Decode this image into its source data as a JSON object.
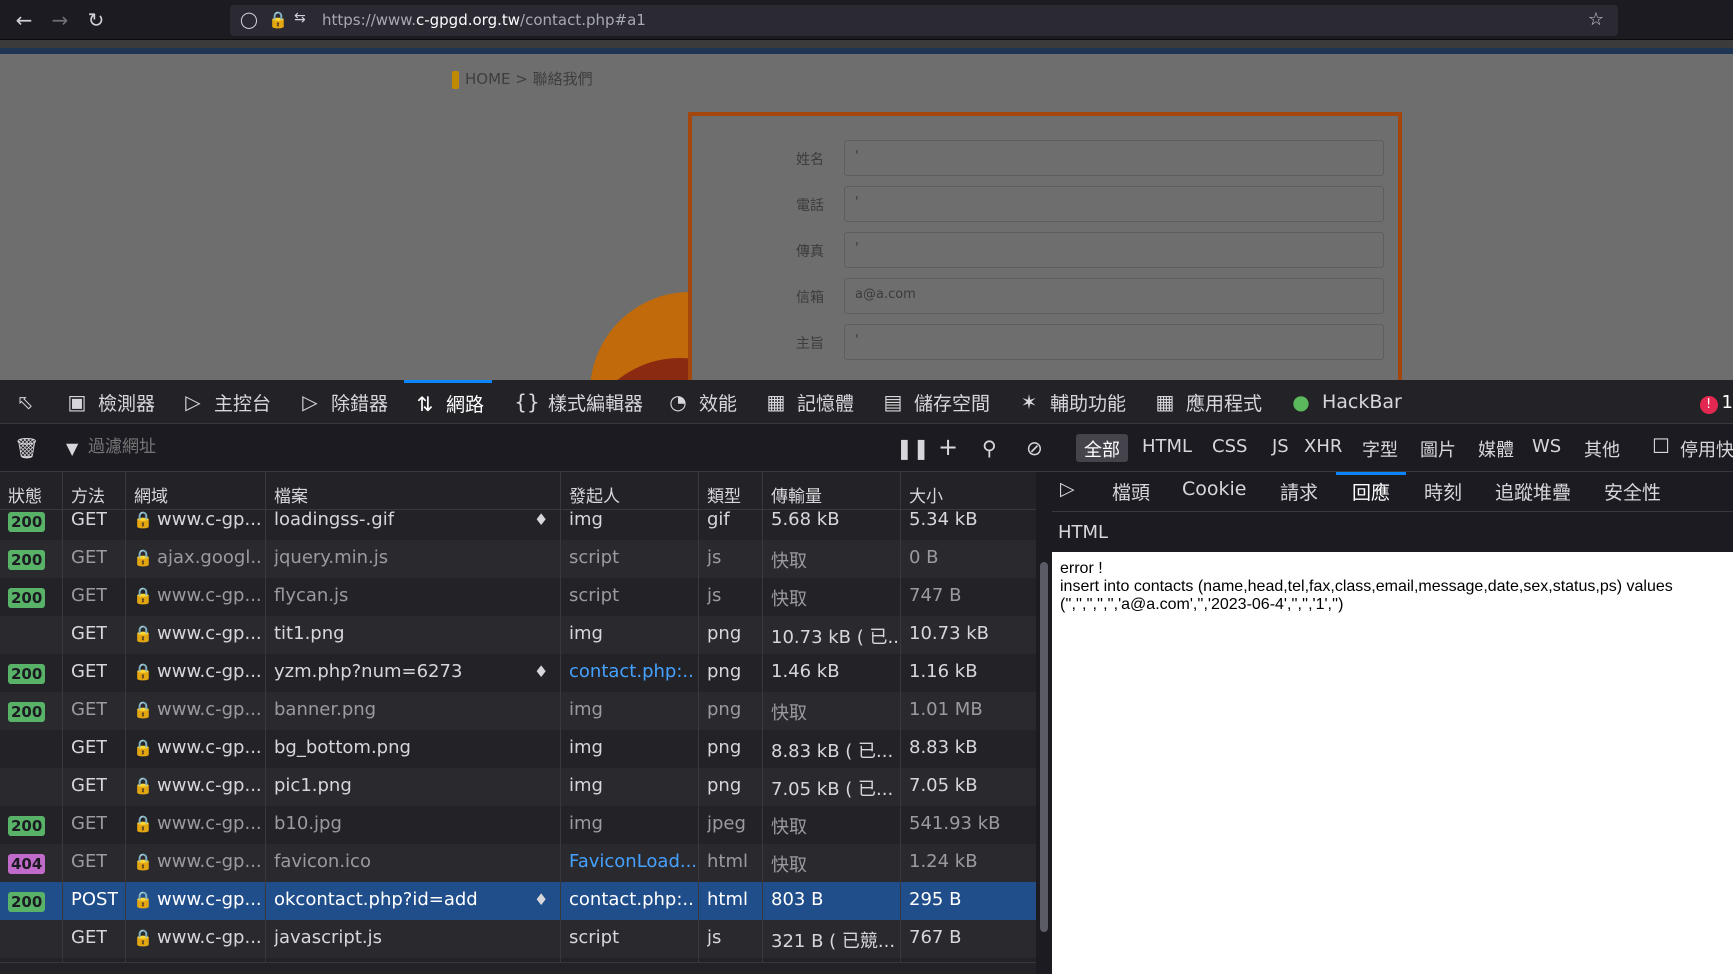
{
  "browser": {
    "url_prefix": "https://www.",
    "url_domain": "c-gpgd.org.tw",
    "url_suffix": "/contact.php#a1"
  },
  "page": {
    "breadcrumb": "HOME > 聯絡我們",
    "form": [
      {
        "label": "姓名",
        "value": "'"
      },
      {
        "label": "電話",
        "value": "'"
      },
      {
        "label": "傳真",
        "value": "'"
      },
      {
        "label": "信箱",
        "value": "a@a.com"
      },
      {
        "label": "主旨",
        "value": "'"
      }
    ]
  },
  "devtools": {
    "tabs": [
      "檢測器",
      "主控台",
      "除錯器",
      "網路",
      "樣式編輯器",
      "效能",
      "記憶體",
      "儲存空間",
      "輔助功能",
      "應用程式",
      "HackBar"
    ],
    "active_tab": "網路",
    "error_count": "1",
    "filter_placeholder": "過濾網址",
    "type_filters": [
      "全部",
      "HTML",
      "CSS",
      "JS",
      "XHR",
      "字型",
      "圖片",
      "媒體",
      "WS",
      "其他"
    ],
    "disable_cache_label": "停用快",
    "columns": [
      "狀態",
      "方法",
      "網域",
      "檔案",
      "發起人",
      "類型",
      "傳輸量",
      "大小"
    ],
    "rows": [
      {
        "status": "200",
        "method": "GET",
        "domain": "www.c-gp...",
        "file": "loadingss-.gif",
        "initiator": "img",
        "type": "gif",
        "transferred": "5.68 kB",
        "size": "5.34 kB",
        "throttled": true,
        "cached": false
      },
      {
        "status": "200",
        "method": "GET",
        "domain": "ajax.googl...",
        "file": "jquery.min.js",
        "initiator": "script",
        "type": "js",
        "transferred": "快取",
        "size": "0 B",
        "throttled": false,
        "cached": true
      },
      {
        "status": "200",
        "method": "GET",
        "domain": "www.c-gp...",
        "file": "flycan.js",
        "initiator": "script",
        "type": "js",
        "transferred": "快取",
        "size": "747 B",
        "throttled": false,
        "cached": true
      },
      {
        "status": "",
        "method": "GET",
        "domain": "www.c-gp...",
        "file": "tit1.png",
        "initiator": "img",
        "type": "png",
        "transferred": "10.73 kB ( 已...",
        "size": "10.73 kB",
        "throttled": false,
        "cached": false
      },
      {
        "status": "200",
        "method": "GET",
        "domain": "www.c-gp...",
        "file": "yzm.php?num=6273",
        "initiator": "contact.php:...",
        "initiator_link": true,
        "type": "png",
        "transferred": "1.46 kB",
        "size": "1.16 kB",
        "throttled": true,
        "cached": false
      },
      {
        "status": "200",
        "method": "GET",
        "domain": "www.c-gp...",
        "file": "banner.png",
        "initiator": "img",
        "type": "png",
        "transferred": "快取",
        "size": "1.01 MB",
        "throttled": false,
        "cached": true
      },
      {
        "status": "",
        "method": "GET",
        "domain": "www.c-gp...",
        "file": "bg_bottom.png",
        "initiator": "img",
        "type": "png",
        "transferred": "8.83 kB ( 已...",
        "size": "8.83 kB",
        "throttled": false,
        "cached": false
      },
      {
        "status": "",
        "method": "GET",
        "domain": "www.c-gp...",
        "file": "pic1.png",
        "initiator": "img",
        "type": "png",
        "transferred": "7.05 kB ( 已...",
        "size": "7.05 kB",
        "throttled": false,
        "cached": false
      },
      {
        "status": "200",
        "method": "GET",
        "domain": "www.c-gp...",
        "file": "b10.jpg",
        "initiator": "img",
        "type": "jpeg",
        "transferred": "快取",
        "size": "541.93 kB",
        "throttled": false,
        "cached": true
      },
      {
        "status": "404",
        "method": "GET",
        "domain": "www.c-gp...",
        "file": "favicon.ico",
        "initiator": "FaviconLoad...",
        "initiator_link": true,
        "type": "html",
        "transferred": "快取",
        "size": "1.24 kB",
        "throttled": false,
        "cached": true
      },
      {
        "status": "200",
        "method": "POST",
        "domain": "www.c-gp...",
        "file": "okcontact.php?id=add",
        "initiator": "contact.php:...",
        "initiator_link": true,
        "type": "html",
        "transferred": "803 B",
        "size": "295 B",
        "throttled": true,
        "cached": false,
        "selected": true
      },
      {
        "status": "",
        "method": "GET",
        "domain": "www.c-gp...",
        "file": "javascript.js",
        "initiator": "script",
        "type": "js",
        "transferred": "321 B ( 已競...",
        "size": "767 B",
        "throttled": false,
        "cached": false
      }
    ],
    "detail_tabs": [
      "檔頭",
      "Cookie",
      "請求",
      "回應",
      "時刻",
      "追蹤堆疊",
      "安全性"
    ],
    "active_detail_tab": "回應",
    "response_format": "HTML",
    "response_line1": "error !",
    "response_line2": "insert into contacts (name,head,tel,fax,class,email,message,date,sex,status,ps) values",
    "response_line3": "('','','','','','a@a.com','','2023-06-4','','','1','')"
  }
}
